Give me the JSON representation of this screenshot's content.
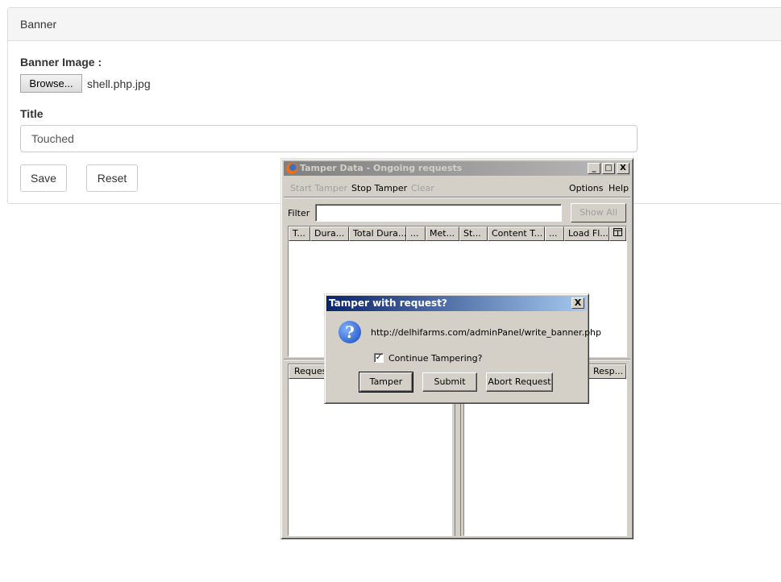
{
  "banner_panel": {
    "heading": "Banner",
    "image_label": "Banner Image :",
    "browse_label": "Browse...",
    "file_name": "shell.php.jpg",
    "title_label": "Title",
    "title_value": "Touched",
    "save_label": "Save",
    "reset_label": "Reset"
  },
  "tamper_window": {
    "title": "Tamper Data - Ongoing requests",
    "caption_buttons": [
      "_",
      "□",
      "X"
    ],
    "menu": {
      "start_tamper": "Start Tamper",
      "stop_tamper": "Stop Tamper",
      "clear": "Clear",
      "options": "Options",
      "help": "Help"
    },
    "filter_label": "Filter",
    "filter_value": "",
    "show_all_label": "Show All",
    "columns": [
      "T...",
      "Dura...",
      "Total Dura...",
      "...",
      "Met...",
      "St...",
      "Content T...",
      "...",
      "Load Fl..."
    ],
    "request_pane_header": "Reques",
    "response_pane_header": "Resp..."
  },
  "tamper_dialog": {
    "title": "Tamper with request?",
    "close_label": "X",
    "url": "http://delhifarms.com/adminPanel/write_banner.php",
    "continue_label": "Continue Tampering?",
    "continue_checked": true,
    "tamper_label": "Tamper",
    "submit_label": "Submit",
    "abort_label": "Abort Request"
  },
  "icons": {
    "window_icon": "firefox-icon",
    "dialog_icon": "question-icon"
  }
}
